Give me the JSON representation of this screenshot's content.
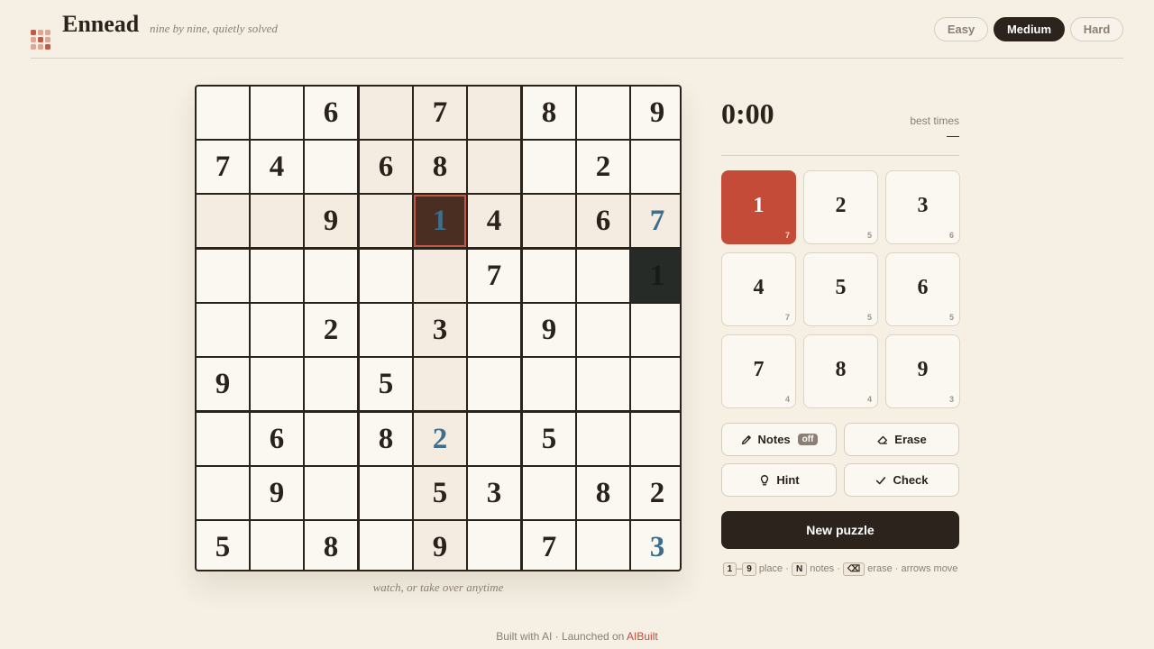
{
  "header": {
    "title": "Ennead",
    "tagline": "nine by nine, quietly solved",
    "difficulties": [
      {
        "label": "Easy",
        "active": false
      },
      {
        "label": "Medium",
        "active": true
      },
      {
        "label": "Hard",
        "active": false
      }
    ]
  },
  "board": {
    "grid": [
      [
        0,
        0,
        6,
        0,
        7,
        0,
        8,
        0,
        9
      ],
      [
        7,
        4,
        0,
        6,
        8,
        0,
        0,
        2,
        0
      ],
      [
        0,
        0,
        9,
        0,
        1,
        4,
        0,
        6,
        7
      ],
      [
        0,
        0,
        0,
        0,
        0,
        7,
        0,
        0,
        1
      ],
      [
        0,
        0,
        2,
        0,
        3,
        0,
        9,
        0,
        0
      ],
      [
        9,
        0,
        0,
        5,
        0,
        0,
        0,
        0,
        0
      ],
      [
        0,
        6,
        0,
        8,
        2,
        0,
        5,
        0,
        0
      ],
      [
        0,
        9,
        0,
        0,
        5,
        3,
        0,
        8,
        2
      ],
      [
        5,
        0,
        8,
        0,
        9,
        0,
        7,
        0,
        3
      ]
    ],
    "user_entries": [
      [
        2,
        4
      ],
      [
        2,
        8
      ],
      [
        6,
        4
      ],
      [
        8,
        8
      ]
    ],
    "selected": [
      2,
      4
    ],
    "dark_cell": [
      3,
      8
    ],
    "caption": "watch, or take over anytime"
  },
  "timer": {
    "value": "0:00",
    "best_label": "best times",
    "best_value": "—"
  },
  "numpad": [
    {
      "digit": "1",
      "count": "7",
      "active": true
    },
    {
      "digit": "2",
      "count": "5",
      "active": false
    },
    {
      "digit": "3",
      "count": "6",
      "active": false
    },
    {
      "digit": "4",
      "count": "7",
      "active": false
    },
    {
      "digit": "5",
      "count": "5",
      "active": false
    },
    {
      "digit": "6",
      "count": "5",
      "active": false
    },
    {
      "digit": "7",
      "count": "4",
      "active": false
    },
    {
      "digit": "8",
      "count": "4",
      "active": false
    },
    {
      "digit": "9",
      "count": "3",
      "active": false
    }
  ],
  "tools": {
    "notes_label": "Notes",
    "notes_state": "off",
    "erase_label": "Erase",
    "hint_label": "Hint",
    "check_label": "Check",
    "new_puzzle_label": "New puzzle"
  },
  "shortcuts": {
    "key_1": "1",
    "dash": "–",
    "key_9": "9",
    "place": "place ·",
    "key_n": "N",
    "notes": "notes ·",
    "key_erase": "⌫",
    "erase_move": "erase · arrows move"
  },
  "footer": {
    "text": "Built with AI · Launched on ",
    "link": "AIBuilt"
  },
  "colors": {
    "accent": "#c44b37",
    "dark": "#2c241c",
    "user_digit": "#3d6e8c",
    "background": "#f5efe4"
  }
}
